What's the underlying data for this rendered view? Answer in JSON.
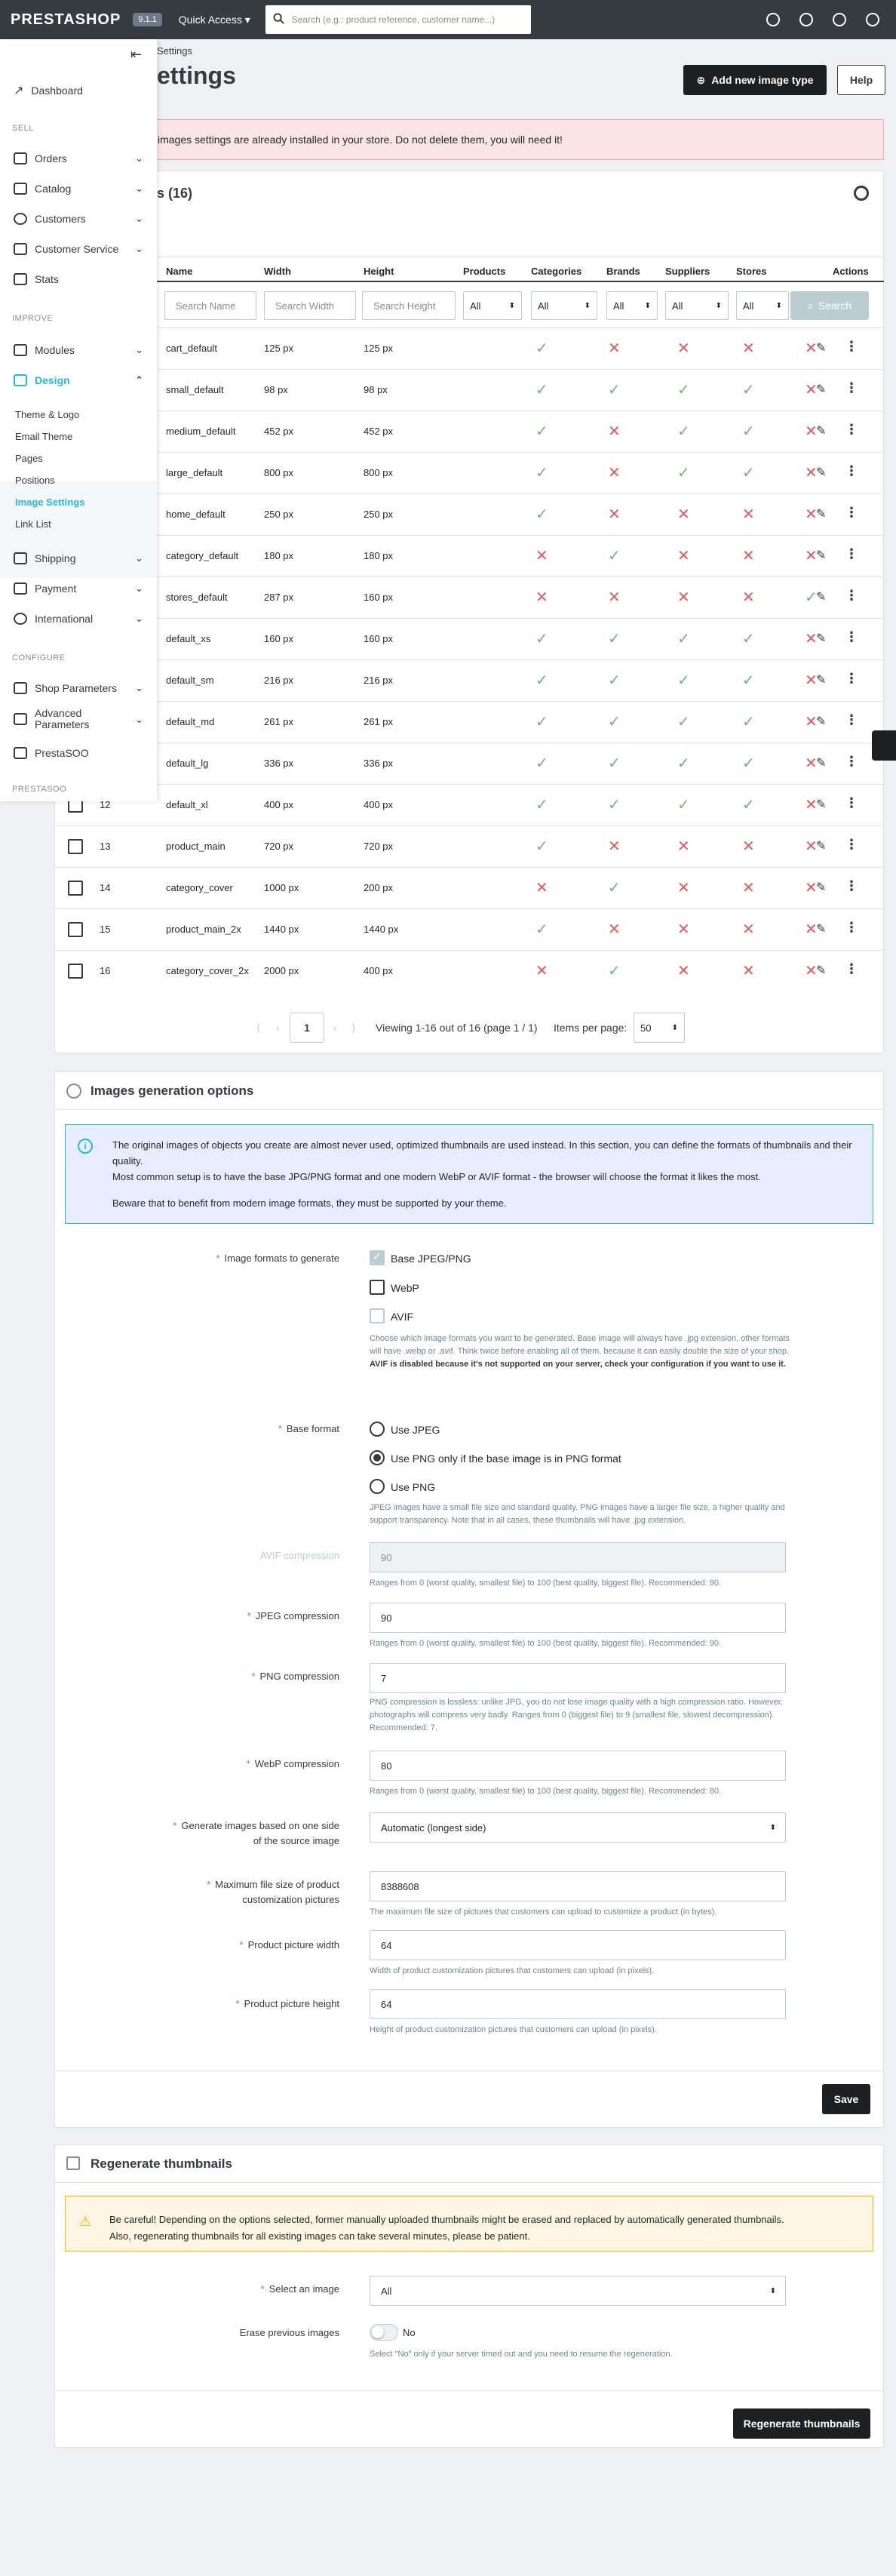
{
  "topbar": {
    "logo": "PRESTASHOP",
    "version": "9.1.1",
    "quick_access": "Quick Access ▾",
    "search_placeholder": "Search (e.g.: product reference, customer name...)"
  },
  "breadcrumb": "Settings",
  "page_title": "ettings",
  "header_buttons": {
    "add": "Add new image type",
    "help": "Help"
  },
  "alert": "images settings are already installed in your store. Do not delete them, you will need it!",
  "sidebar": {
    "dashboard": "Dashboard",
    "sell_section": "SELL",
    "orders": "Orders",
    "catalog": "Catalog",
    "customers": "Customers",
    "customer_service": "Customer Service",
    "stats": "Stats",
    "improve_section": "IMPROVE",
    "modules": "Modules",
    "design": "Design",
    "design_sub": [
      "Theme & Logo",
      "Email Theme",
      "Pages",
      "Positions",
      "Image Settings",
      "Link List"
    ],
    "shipping": "Shipping",
    "payment": "Payment",
    "international": "International",
    "configure_section": "CONFIGURE",
    "shop_parameters": "Shop Parameters",
    "advanced_parameters": "Advanced Parameters",
    "prestasoo": "PrestaSOO",
    "prestasoo_section": "PRESTASOO"
  },
  "table": {
    "title": "s (16)",
    "columns": [
      "Name",
      "Width",
      "Height",
      "Products",
      "Categories",
      "Brands",
      "Suppliers",
      "Stores",
      "Actions"
    ],
    "filters": {
      "name": "Search Name",
      "width": "Search Width",
      "height": "Search Height",
      "all": "All",
      "search": "Search"
    },
    "rows": [
      {
        "id": "",
        "name": "cart_default",
        "width": "125 px",
        "height": "125 px",
        "flags": [
          1,
          0,
          0,
          0,
          0
        ]
      },
      {
        "id": "",
        "name": "small_default",
        "width": "98 px",
        "height": "98 px",
        "flags": [
          1,
          1,
          1,
          1,
          0
        ]
      },
      {
        "id": "",
        "name": "medium_default",
        "width": "452 px",
        "height": "452 px",
        "flags": [
          1,
          0,
          1,
          1,
          0
        ]
      },
      {
        "id": "",
        "name": "large_default",
        "width": "800 px",
        "height": "800 px",
        "flags": [
          1,
          0,
          1,
          1,
          0
        ]
      },
      {
        "id": "",
        "name": "home_default",
        "width": "250 px",
        "height": "250 px",
        "flags": [
          1,
          0,
          0,
          0,
          0
        ]
      },
      {
        "id": "",
        "name": "category_default",
        "width": "180 px",
        "height": "180 px",
        "flags": [
          0,
          1,
          0,
          0,
          0
        ]
      },
      {
        "id": "",
        "name": "stores_default",
        "width": "287 px",
        "height": "160 px",
        "flags": [
          0,
          0,
          0,
          0,
          1
        ]
      },
      {
        "id": "",
        "name": "default_xs",
        "width": "160 px",
        "height": "160 px",
        "flags": [
          1,
          1,
          1,
          1,
          0
        ]
      },
      {
        "id": "",
        "name": "default_sm",
        "width": "216 px",
        "height": "216 px",
        "flags": [
          1,
          1,
          1,
          1,
          0
        ]
      },
      {
        "id": "",
        "name": "default_md",
        "width": "261 px",
        "height": "261 px",
        "flags": [
          1,
          1,
          1,
          1,
          0
        ]
      },
      {
        "id": "",
        "name": "default_lg",
        "width": "336 px",
        "height": "336 px",
        "flags": [
          1,
          1,
          1,
          1,
          0
        ]
      },
      {
        "id": "12",
        "name": "default_xl",
        "width": "400 px",
        "height": "400 px",
        "flags": [
          1,
          1,
          1,
          1,
          0
        ]
      },
      {
        "id": "13",
        "name": "product_main",
        "width": "720 px",
        "height": "720 px",
        "flags": [
          1,
          0,
          0,
          0,
          0
        ]
      },
      {
        "id": "14",
        "name": "category_cover",
        "width": "1000 px",
        "height": "200 px",
        "flags": [
          0,
          1,
          0,
          0,
          0
        ]
      },
      {
        "id": "15",
        "name": "product_main_2x",
        "width": "1440 px",
        "height": "1440 px",
        "flags": [
          1,
          0,
          0,
          0,
          0
        ]
      },
      {
        "id": "16",
        "name": "category_cover_2x",
        "width": "2000 px",
        "height": "400 px",
        "flags": [
          0,
          1,
          0,
          0,
          0
        ]
      }
    ],
    "pagination": {
      "page": "1",
      "viewing": "Viewing 1-16 out of 16 (page 1 / 1)",
      "per_page_label": "Items per page:",
      "per_page": "50"
    }
  },
  "generation": {
    "title": "Images generation options",
    "info": [
      "The original images of objects you create are almost never used, optimized thumbnails are used instead. In this section, you can define the formats of thumbnails and their quality.",
      "Most common setup is to have the base JPG/PNG format and one modern WebP or AVIF format - the browser will choose the format it likes the most.",
      "Beware that to benefit from modern image formats, they must be supported by your theme."
    ],
    "formats_label": "Image formats to generate",
    "formats": [
      "Base JPEG/PNG",
      "WebP",
      "AVIF"
    ],
    "formats_hint": "Choose which image formats you want to be generated. Base image will always have .jpg extension, other formats will have .webp or .avif. Think twice before enabling all of them, because it can easily double the size of your shop.",
    "formats_hint_bold": "AVIF is disabled because it's not supported on your server, check your configuration if you want to use it.",
    "base_label": "Base format",
    "base_options": [
      "Use JPEG",
      "Use PNG only if the base image is in PNG format",
      "Use PNG"
    ],
    "base_hint": "JPEG images have a small file size and standard quality. PNG images have a larger file size, a higher quality and support transparency. Note that in all cases, these thumbnails will have .jpg extension.",
    "avif_label": "AVIF compression",
    "avif_value": "90",
    "avif_hint": "Ranges from 0 (worst quality, smallest file) to 100 (best quality, biggest file). Recommended: 90.",
    "jpeg_label": "JPEG compression",
    "jpeg_value": "90",
    "jpeg_hint": "Ranges from 0 (worst quality, smallest file) to 100 (best quality, biggest file). Recommended: 90.",
    "png_label": "PNG compression",
    "png_value": "7",
    "png_hint": "PNG compression is lossless: unlike JPG, you do not lose image quality with a high compression ratio. However, photographs will compress very badly. Ranges from 0 (biggest file) to 9 (smallest file, slowest decompression). Recommended: 7.",
    "webp_label": "WebP compression",
    "webp_value": "80",
    "webp_hint": "Ranges from 0 (worst quality, smallest file) to 100 (best quality, biggest file). Recommended: 80.",
    "side_label_1": "Generate images based on one side",
    "side_label_2": "of the source image",
    "side_value": "Automatic (longest side)",
    "maxsize_label_1": "Maximum file size of product",
    "maxsize_label_2": "customization pictures",
    "maxsize_value": "8388608",
    "maxsize_hint": "The maximum file size of pictures that customers can upload to customize a product (in bytes).",
    "pwidth_label": "Product picture width",
    "pwidth_value": "64",
    "pwidth_hint": "Width of product customization pictures that customers can upload (in pixels).",
    "pheight_label": "Product picture height",
    "pheight_value": "64",
    "pheight_hint": "Height of product customization pictures that customers can upload (in pixels).",
    "save": "Save"
  },
  "regenerate": {
    "title": "Regenerate thumbnails",
    "warning_1": "Be careful! Depending on the options selected, former manually uploaded thumbnails might be erased and replaced by automatically generated thumbnails.",
    "warning_2": "Also, regenerating thumbnails for all existing images can take several minutes, please be patient.",
    "select_label": "Select an image",
    "select_value": "All",
    "erase_label": "Erase previous images",
    "erase_value": "No",
    "erase_hint": "Select \"No\" only if your server timed out and you need to resume the regeneration.",
    "button": "Regenerate thumbnails"
  },
  "colors": {
    "accent": "#25b9d7",
    "success": "#70b580",
    "danger": "#e35a5a",
    "dark": "#363a41"
  }
}
